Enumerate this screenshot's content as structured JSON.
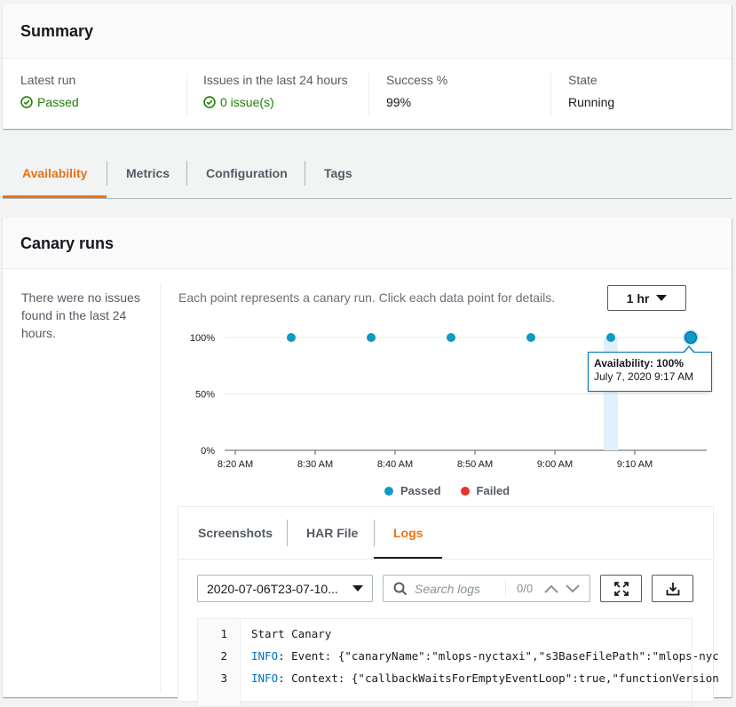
{
  "summary": {
    "title": "Summary",
    "metrics": [
      {
        "label": "Latest run",
        "value": "Passed",
        "status": "ok"
      },
      {
        "label": "Issues in the last 24 hours",
        "value": "0 issue(s)",
        "status": "ok"
      },
      {
        "label": "Success %",
        "value": "99%"
      },
      {
        "label": "State",
        "value": "Running"
      }
    ]
  },
  "tabs": [
    {
      "label": "Availability",
      "active": true
    },
    {
      "label": "Metrics"
    },
    {
      "label": "Configuration"
    },
    {
      "label": "Tags"
    }
  ],
  "canary": {
    "title": "Canary runs",
    "note": "There were no issues found in the last 24 hours.",
    "caption": "Each point represents a canary run. Click each data point for details.",
    "range": "1 hr",
    "tooltip": {
      "title": "Availability: 100%",
      "subtitle": "July 7, 2020 9:17 AM"
    },
    "legend": [
      {
        "label": "Passed",
        "color": "#0d9ac4"
      },
      {
        "label": "Failed",
        "color": "#e8352b"
      }
    ]
  },
  "chart_data": {
    "type": "scatter",
    "x_ticks": [
      "8:20 AM",
      "8:30 AM",
      "8:40 AM",
      "8:50 AM",
      "9:00 AM",
      "9:10 AM"
    ],
    "y_ticks": [
      "100%",
      "50%",
      "0%"
    ],
    "ylim": [
      0,
      100
    ],
    "series": [
      {
        "name": "Passed",
        "points": [
          {
            "x": "8:27 AM",
            "y": 100
          },
          {
            "x": "8:37 AM",
            "y": 100
          },
          {
            "x": "8:47 AM",
            "y": 100
          },
          {
            "x": "8:57 AM",
            "y": 100
          },
          {
            "x": "9:07 AM",
            "y": 100
          },
          {
            "x": "9:17 AM",
            "y": 100
          }
        ]
      },
      {
        "name": "Failed",
        "points": []
      }
    ]
  },
  "details": {
    "tabs": [
      {
        "label": "Screenshots"
      },
      {
        "label": "HAR File"
      },
      {
        "label": "Logs",
        "active": true
      }
    ],
    "log_select": "2020-07-06T23-07-10...",
    "search_placeholder": "Search logs",
    "match_count": "0/0",
    "log_lines": [
      {
        "num": "1",
        "level": "",
        "text": "Start Canary"
      },
      {
        "num": "2",
        "level": "INFO",
        "text": ": Event: {\"canaryName\":\"mlops-nyctaxi\",\"s3BaseFilePath\":\"mlops-nyc"
      },
      {
        "num": "3",
        "level": "INFO",
        "text": ": Context: {\"callbackWaitsForEmptyEventLoop\":true,\"functionVersion"
      }
    ]
  }
}
